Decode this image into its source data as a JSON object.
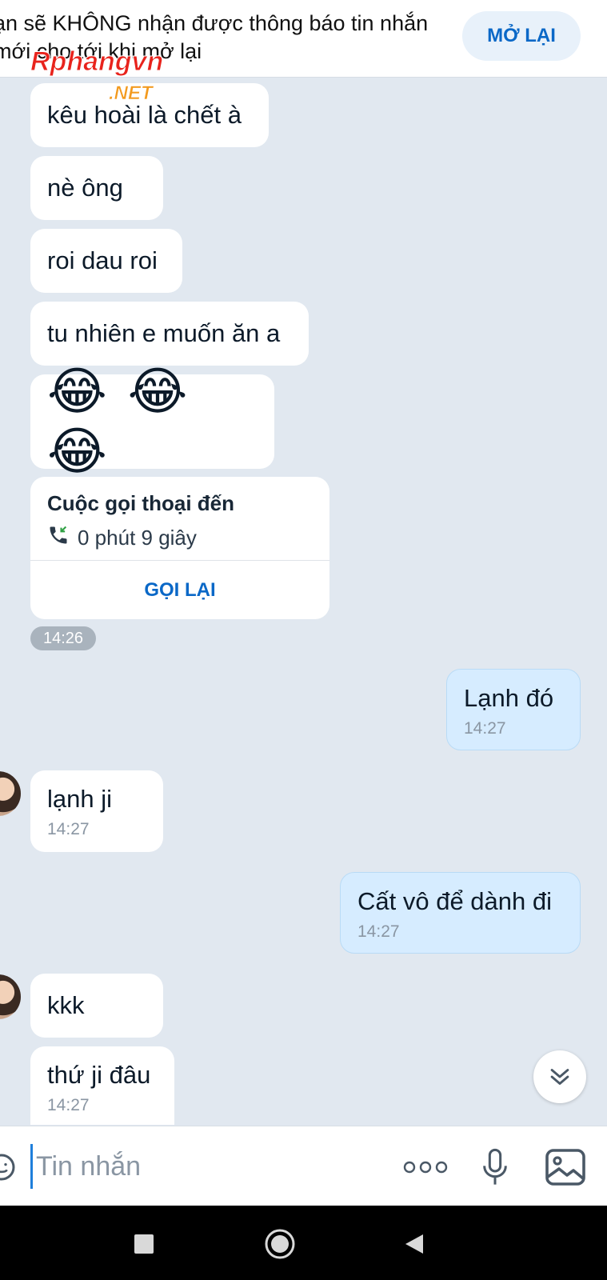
{
  "banner": {
    "text": "ạn sẽ KHÔNG nhận được thông báo tin nhắn mới cho tới khi mở lại",
    "reopen_label": "MỞ LẠI"
  },
  "watermark": {
    "main": "Rphangvn",
    "sub": ".NET"
  },
  "messages": [
    {
      "text": "kêu hoài là chết à"
    },
    {
      "text": "nè ông"
    },
    {
      "text": "roi dau roi"
    },
    {
      "text": "tu nhiên e muốn ăn a"
    },
    {
      "emoji": "😂 😂 😂"
    },
    {
      "call_title": "Cuộc gọi thoại đến",
      "call_duration": "0 phút 9 giây",
      "call_back_label": "GỌI LẠI"
    },
    {
      "time_pill": "14:26"
    },
    {
      "text": "Lạnh đó",
      "time": "14:27"
    },
    {
      "text": "lạnh ji",
      "time": "14:27"
    },
    {
      "text": "Cất vô để dành đi",
      "time": "14:27"
    },
    {
      "text": "kkk"
    },
    {
      "text": "thứ ji đâu",
      "time": "14:27"
    }
  ],
  "input": {
    "placeholder": "Tin nhắn"
  },
  "icons": {
    "emoji": "emoji-icon",
    "more": "more-icon",
    "mic": "mic-icon",
    "image": "image-icon",
    "scroll": "chevron-double-down-icon",
    "call": "incoming-call-icon"
  },
  "colors": {
    "accent": "#0a68c7",
    "outgoing_bubble": "#d6ecff",
    "background": "#e1e8f0"
  }
}
